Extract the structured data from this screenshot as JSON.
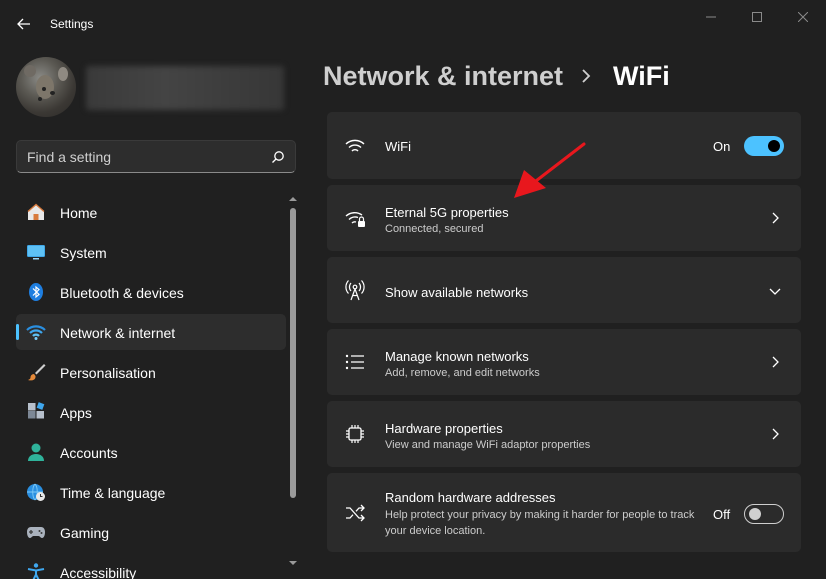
{
  "window": {
    "title": "Settings"
  },
  "search": {
    "placeholder": "Find a setting"
  },
  "sidebar": {
    "items": [
      {
        "label": "Home",
        "icon": "home-icon"
      },
      {
        "label": "System",
        "icon": "system-icon"
      },
      {
        "label": "Bluetooth & devices",
        "icon": "bluetooth-icon"
      },
      {
        "label": "Network & internet",
        "icon": "network-icon",
        "active": true
      },
      {
        "label": "Personalisation",
        "icon": "brush-icon"
      },
      {
        "label": "Apps",
        "icon": "apps-icon"
      },
      {
        "label": "Accounts",
        "icon": "accounts-icon"
      },
      {
        "label": "Time & language",
        "icon": "globe-clock-icon"
      },
      {
        "label": "Gaming",
        "icon": "gamepad-icon"
      },
      {
        "label": "Accessibility",
        "icon": "accessibility-icon"
      }
    ]
  },
  "breadcrumb": {
    "parent": "Network & internet",
    "current": "WiFi"
  },
  "cards": {
    "wifi": {
      "title": "WiFi",
      "toggle_label": "On",
      "toggle_on": true
    },
    "network": {
      "title": "Eternal 5G properties",
      "subtitle": "Connected, secured"
    },
    "available": {
      "title": "Show available networks"
    },
    "known": {
      "title": "Manage known networks",
      "subtitle": "Add, remove, and edit networks"
    },
    "hardware": {
      "title": "Hardware properties",
      "subtitle": "View and manage WiFi adaptor properties"
    },
    "random": {
      "title": "Random hardware addresses",
      "subtitle": "Help protect your privacy by making it harder for people to track your device location.",
      "toggle_label": "Off",
      "toggle_on": false
    }
  },
  "colors": {
    "accent": "#4cc2ff",
    "arrow": "#e8171d",
    "card": "#2b2b2b",
    "background": "#202020"
  }
}
